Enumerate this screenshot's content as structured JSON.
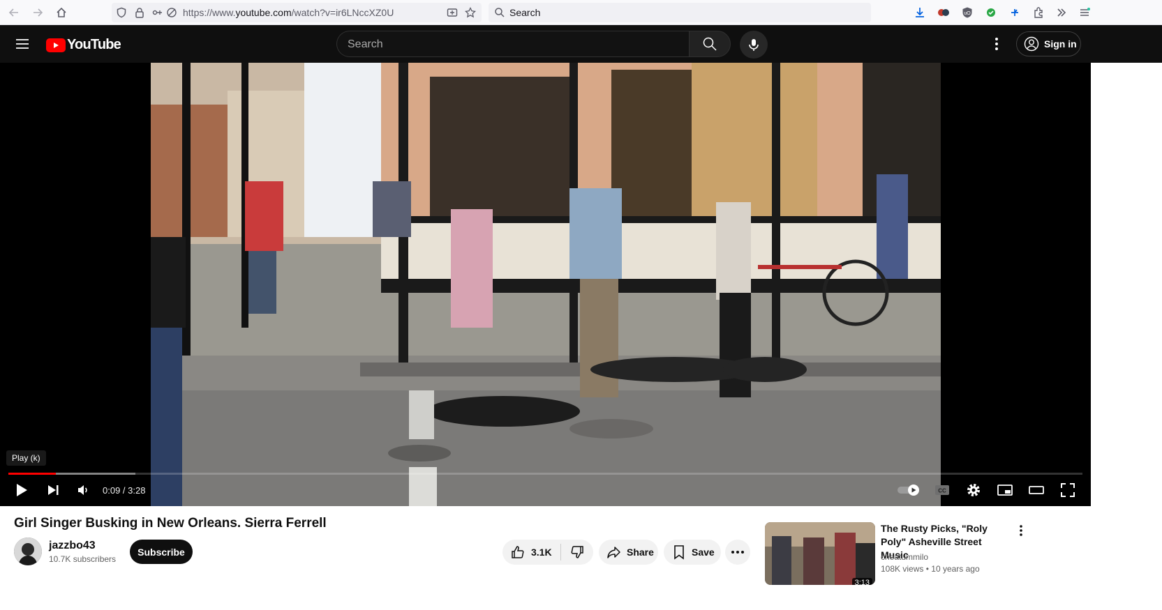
{
  "browser": {
    "url_prefix": "https://www.",
    "url_domain": "youtube.com",
    "url_path": "/watch?v=ir6LNccXZ0U",
    "search_placeholder": "Search"
  },
  "masthead": {
    "logo_text": "YouTube",
    "search_placeholder": "Search",
    "signin_label": "Sign in"
  },
  "player": {
    "tooltip": "Play (k)",
    "time_current": "0:09",
    "time_separator": " / ",
    "time_total": "3:28",
    "progress_played_fraction": 0.044,
    "progress_buffered_fraction": 0.118
  },
  "video": {
    "title": "Girl Singer Busking in New Orleans. Sierra Ferrell",
    "channel_name": "jazzbo43",
    "subscribers": "10.7K subscribers",
    "subscribe_label": "Subscribe",
    "likes": "3.1K",
    "share_label": "Share",
    "save_label": "Save"
  },
  "recommendation": {
    "title": "The Rusty Picks, \"Roly Poly\" Asheville Street Music",
    "channel": "cheatummilo",
    "views": "108K views",
    "age": "10 years ago",
    "duration": "3:13"
  },
  "colors": {
    "youtube_red": "#ff0000",
    "dark_bg": "#0f0f0f",
    "progress_played": "#ff0000"
  }
}
